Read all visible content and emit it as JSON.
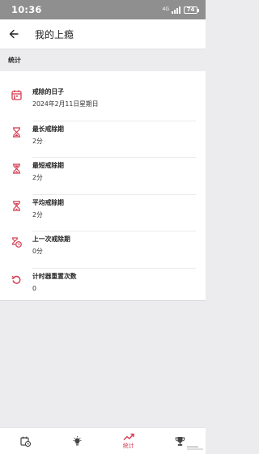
{
  "status_bar": {
    "time": "10:36",
    "network": "4G",
    "battery": "74"
  },
  "app_bar": {
    "title": "我的上瘾"
  },
  "section": {
    "title": "统计"
  },
  "stats": [
    {
      "icon": "calendar-icon",
      "label": "戒除的日子",
      "value": "2024年2月11日星期日"
    },
    {
      "icon": "hourglass-icon",
      "label": "最长戒除期",
      "value": "2分"
    },
    {
      "icon": "hourglass-icon",
      "label": "最短戒除期",
      "value": "2分"
    },
    {
      "icon": "hourglass-icon",
      "label": "平均戒除期",
      "value": "2分"
    },
    {
      "icon": "hourglass-clock-icon",
      "label": "上一次戒除期",
      "value": "0分"
    },
    {
      "icon": "reset-icon",
      "label": "计时器重置次数",
      "value": "0"
    }
  ],
  "bottom_nav": {
    "stats_label": "统计",
    "active": "stats"
  },
  "colors": {
    "accent": "#d63b52",
    "status_bar": "#8f8f8f",
    "background": "#ececee"
  }
}
